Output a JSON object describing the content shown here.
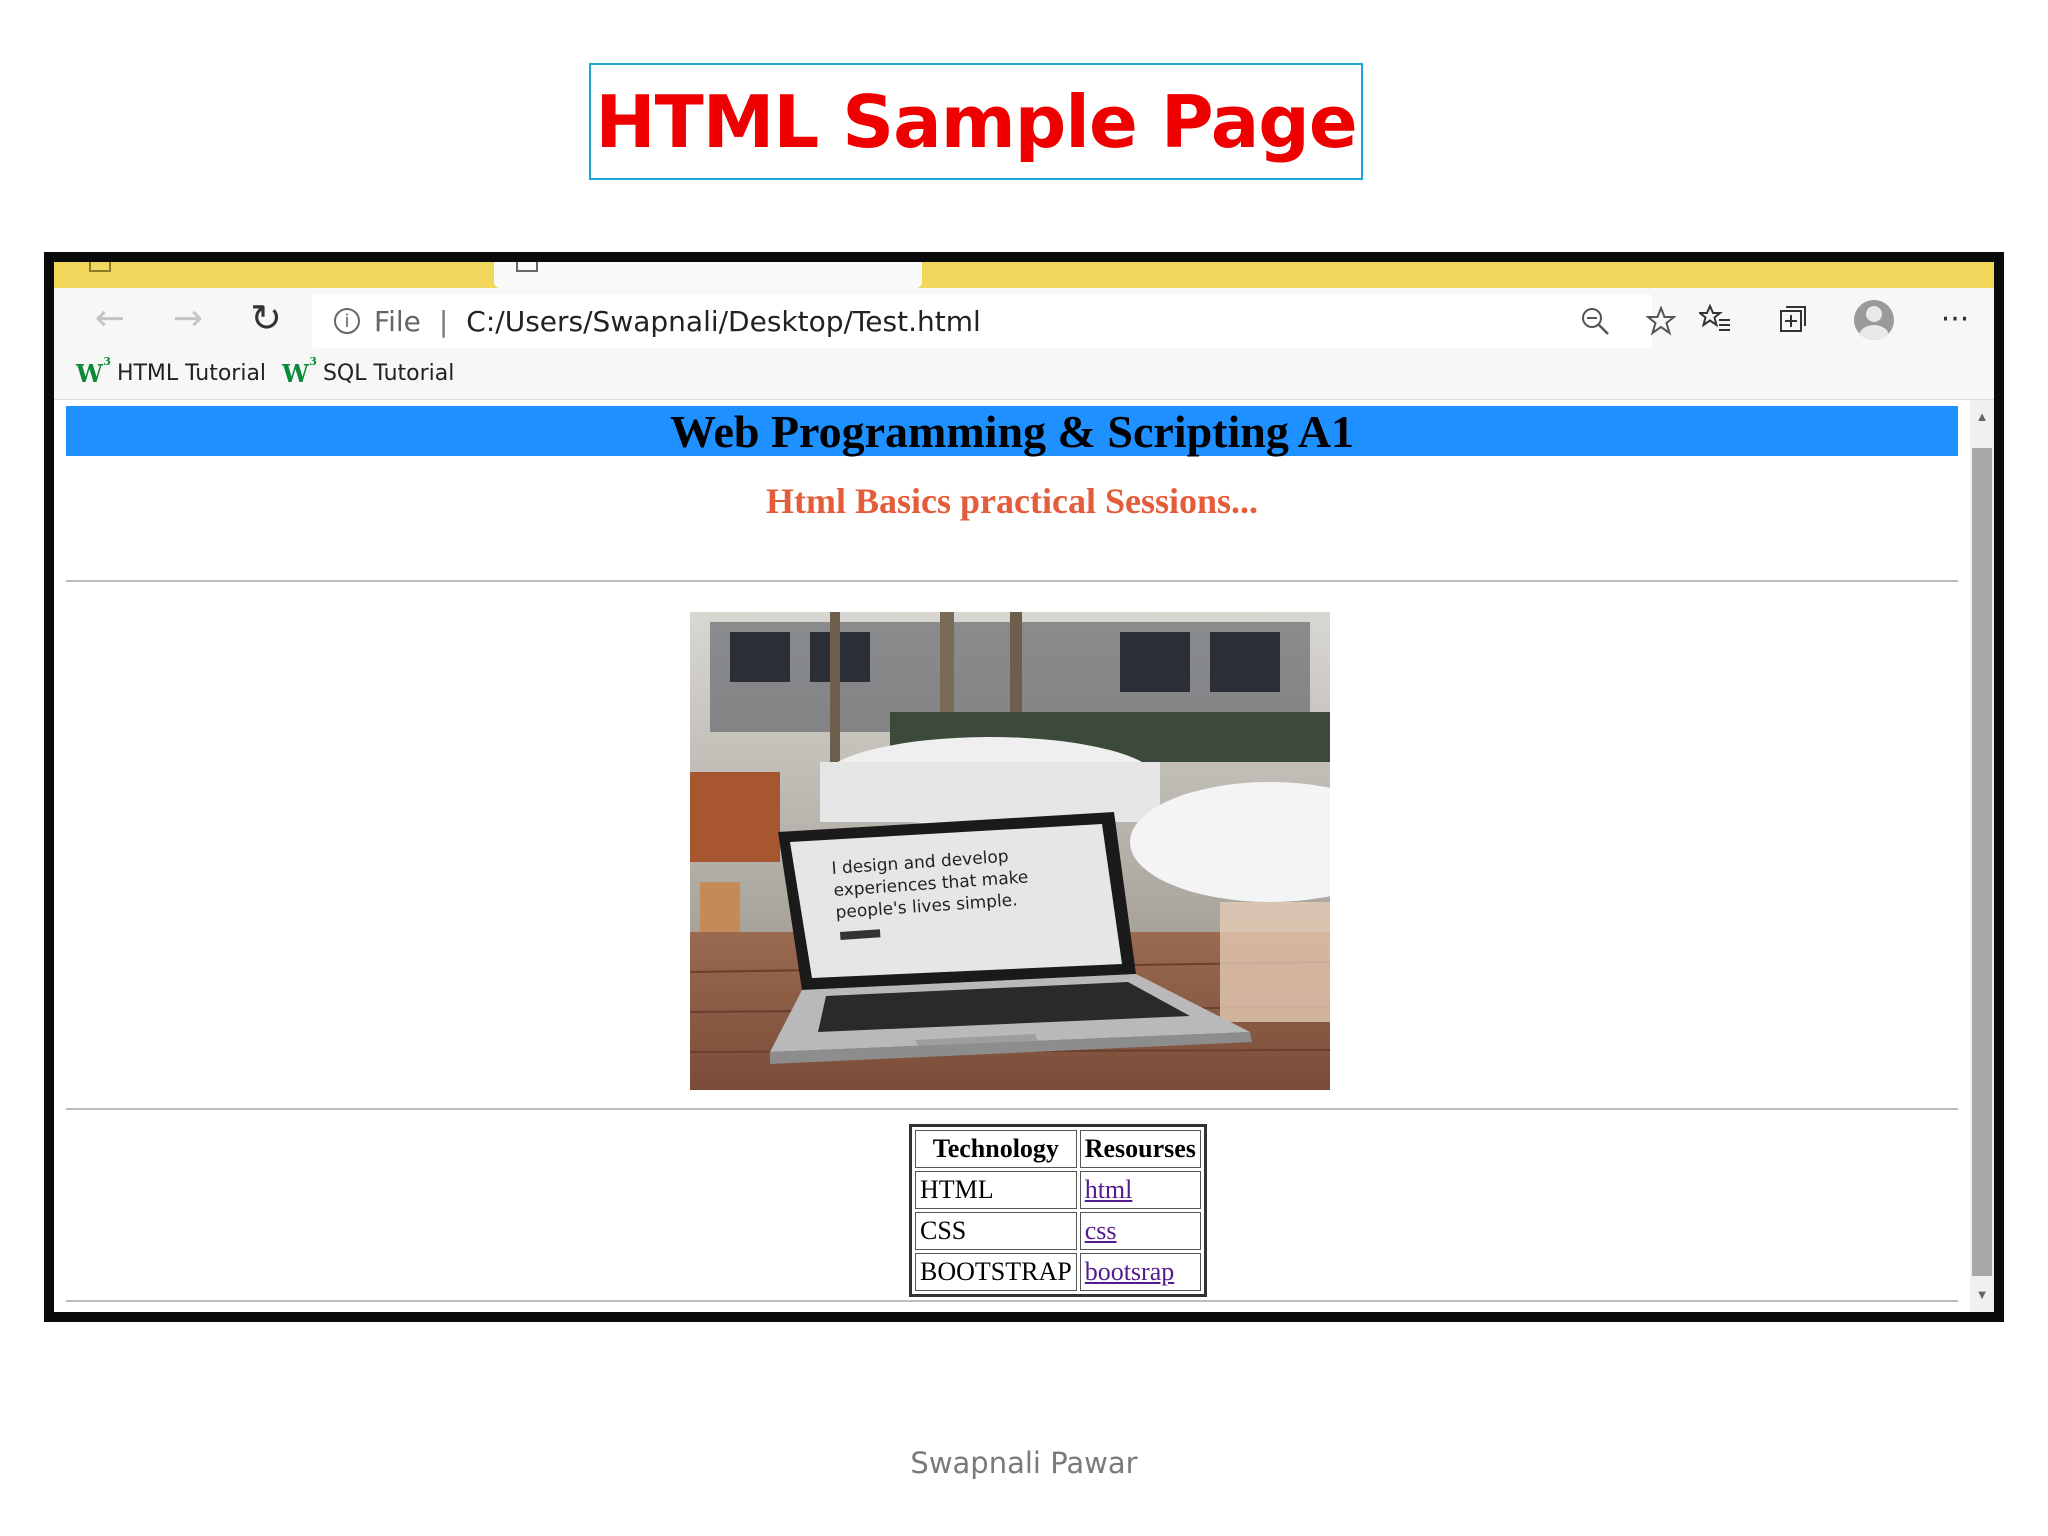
{
  "slide": {
    "title": "HTML Sample Page",
    "footer": "Swapnali Pawar"
  },
  "browser": {
    "addressbar": {
      "scheme_label": "File",
      "separator": "|",
      "url": "C:/Users/Swapnali/Desktop/Test.html"
    },
    "bookmarks": [
      {
        "label": "HTML Tutorial",
        "icon": "w3schools-icon"
      },
      {
        "label": "SQL Tutorial",
        "icon": "w3schools-icon"
      }
    ],
    "colors": {
      "tabstrip": "#f1d75c",
      "toolbar": "#f7f7f7"
    }
  },
  "webpage": {
    "header": "Web Programming & Scripting A1",
    "subheader": "Html Basics practical Sessions...",
    "photo_screen_text": {
      "line1": "I design and develop",
      "line2": "experiences that make",
      "line3": "people's lives simple."
    },
    "table": {
      "headers": [
        "Technology",
        "Resourses"
      ],
      "rows": [
        {
          "technology": "HTML",
          "link": "html"
        },
        {
          "technology": "CSS",
          "link": "css"
        },
        {
          "technology": "BOOTSTRAP",
          "link": "bootsrap"
        }
      ]
    },
    "colors": {
      "header_bg": "#1e90ff",
      "subheader": "#e45c3a",
      "link": "#551a8b"
    }
  }
}
